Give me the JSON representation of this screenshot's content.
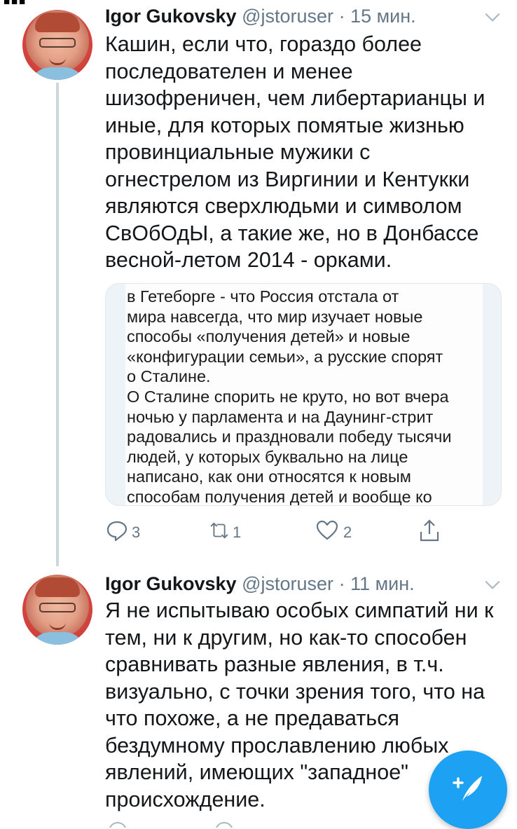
{
  "tweets": [
    {
      "author_name": "Igor Gukovsky",
      "handle": "@jstoruser",
      "separator": "·",
      "time": "15 мин.",
      "text": "Кашин, если что, гораздо более\nпоследователен и менее\nшизофреничен, чем либертарианцы и\nиные, для которых помятые жизнью\nпровинциальные мужики с\nогнестрелом из Виргинии и Кентукки\nявляются сверхлюдьми и символом\nСвОбОдЫ, а такие же, но в Донбассе\nвесной-летом 2014 - орками.",
      "media_text": "в Гетеборге - что Россия отстала от\nмира навсегда, что мир изучает новые\nспособы «получения детей» и новые\n«конфигурации семьи», а русские спорят\nо Сталине.\nО Сталине спорить не круто, но вот вчера\nночью у парламента и на Даунинг-стрит\nрадовались и праздновали победу тысячи\nлюдей, у которых буквально на лице\nнаписано, как они относятся к новым\nспособам получения детей и вообще ко",
      "replies": "3",
      "retweets": "1",
      "likes": "2"
    },
    {
      "author_name": "Igor Gukovsky",
      "handle": "@jstoruser",
      "separator": "·",
      "time": "11 мин.",
      "text": "Я не испытываю особых симпатий ни к\nтем, ни к другим, но как-то способен\nсравнивать разные явления, в т.ч.\nвизуально, с точки зрения того, что на\nчто похоже, а не предаваться\nбездумному прославлению любых\nявлений, имеющих \"западное\"\nпроисхождение."
    }
  ],
  "icons": {
    "reply": "reply-icon",
    "retweet": "retweet-icon",
    "like": "heart-icon",
    "share": "share-icon",
    "chevron": "chevron-down-icon",
    "compose": "compose-tweet-icon"
  },
  "colors": {
    "accent": "#1da1f2",
    "muted": "#657786",
    "thread_line": "#ccd6dd"
  }
}
